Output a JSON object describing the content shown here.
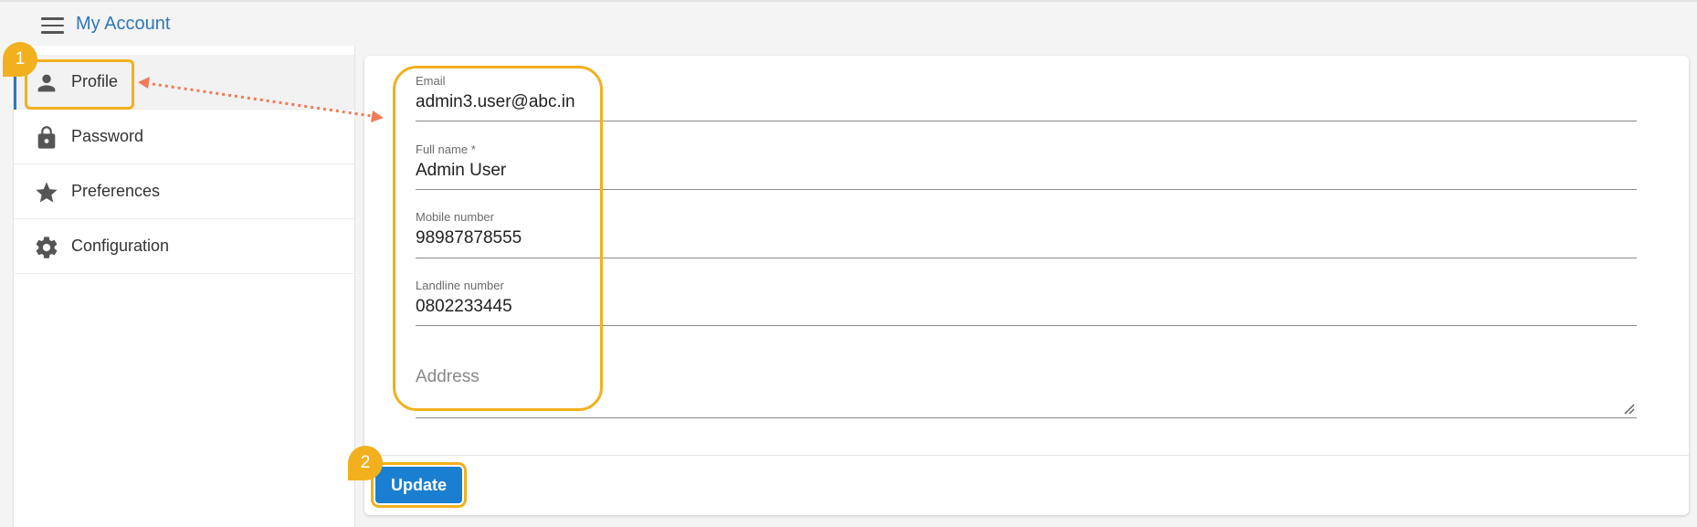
{
  "header": {
    "title": "My Account",
    "menu_icon": "hamburger-menu-icon"
  },
  "sidebar": {
    "items": [
      {
        "label": "Profile",
        "icon": "person-icon",
        "active": true
      },
      {
        "label": "Password",
        "icon": "lock-icon",
        "active": false
      },
      {
        "label": "Preferences",
        "icon": "star-icon",
        "active": false
      },
      {
        "label": "Configuration",
        "icon": "gear-icon",
        "active": false
      }
    ]
  },
  "profile_form": {
    "email": {
      "label": "Email",
      "value": "admin3.user@abc.in"
    },
    "full_name": {
      "label": "Full name *",
      "value": "Admin User"
    },
    "mobile": {
      "label": "Mobile number",
      "value": "98987878555"
    },
    "landline": {
      "label": "Landline number",
      "value": "0802233445"
    },
    "address": {
      "placeholder": "Address",
      "value": ""
    },
    "update_label": "Update"
  },
  "annotations": {
    "step1": "1",
    "step2": "2",
    "highlight_color": "#f2b01e",
    "arrow_color": "#f07a5a"
  },
  "colors": {
    "accent": "#2f77b5",
    "button": "#1a7fd1"
  }
}
